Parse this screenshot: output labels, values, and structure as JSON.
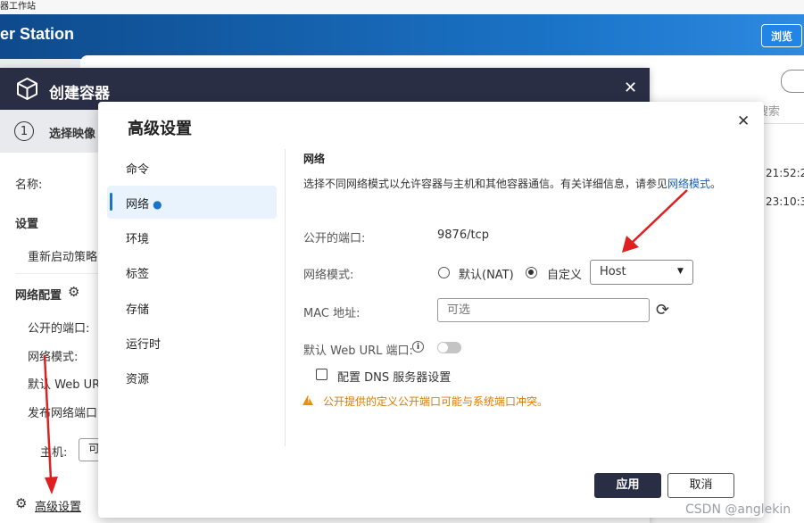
{
  "window": {
    "title_fragment": "器工作站"
  },
  "app": {
    "title_fragment": "er Station",
    "browse_button": "浏览"
  },
  "right_panel": {
    "search_placeholder": "搜索",
    "time1": "21:52:2",
    "time2": "23:10:3"
  },
  "create_dialog": {
    "title": "创建容器",
    "step_number": "1",
    "step_label": "选择映像",
    "name_label": "名称:",
    "settings_label": "设置",
    "restart_policy_label": "重新启动策略",
    "network_config_label": "网络配置",
    "public_port_label": "公开的端口:",
    "network_mode_label": "网络模式:",
    "default_web_url_label": "默认 Web URL",
    "publish_port_label": "发布网络端口",
    "host_label": "主机:",
    "host_input_value": "可",
    "advanced_link": "高级设置"
  },
  "advanced_dialog": {
    "title": "高级设置",
    "nav": [
      {
        "label": "命令",
        "active": false
      },
      {
        "label": "网络",
        "active": true
      },
      {
        "label": "环境",
        "active": false
      },
      {
        "label": "标签",
        "active": false
      },
      {
        "label": "存储",
        "active": false
      },
      {
        "label": "运行时",
        "active": false
      },
      {
        "label": "资源",
        "active": false
      }
    ],
    "network": {
      "section_title": "网络",
      "description": "选择不同网络模式以允许容器与主机和其他容器通信。有关详细信息，请参见",
      "description_link": "网络模式",
      "description_end": "。",
      "public_port_label": "公开的端口:",
      "public_port_value": "9876/tcp",
      "network_mode_label": "网络模式:",
      "mode_default_label": "默认(NAT)",
      "mode_custom_label": "自定义",
      "mode_selected": "custom",
      "custom_select_value": "Host",
      "mac_label": "MAC 地址:",
      "mac_placeholder": "可选",
      "web_url_port_label": "默认 Web URL 端口:",
      "web_url_port_enabled": false,
      "dns_checkbox_label": "配置 DNS 服务器设置",
      "dns_checked": false,
      "warning": "公开提供的定义公开端口可能与系统端口冲突。"
    },
    "apply_button": "应用",
    "cancel_button": "取消"
  },
  "annotations": {
    "arrow_color": "#e02020"
  },
  "watermark": "CSDN @anglekin"
}
